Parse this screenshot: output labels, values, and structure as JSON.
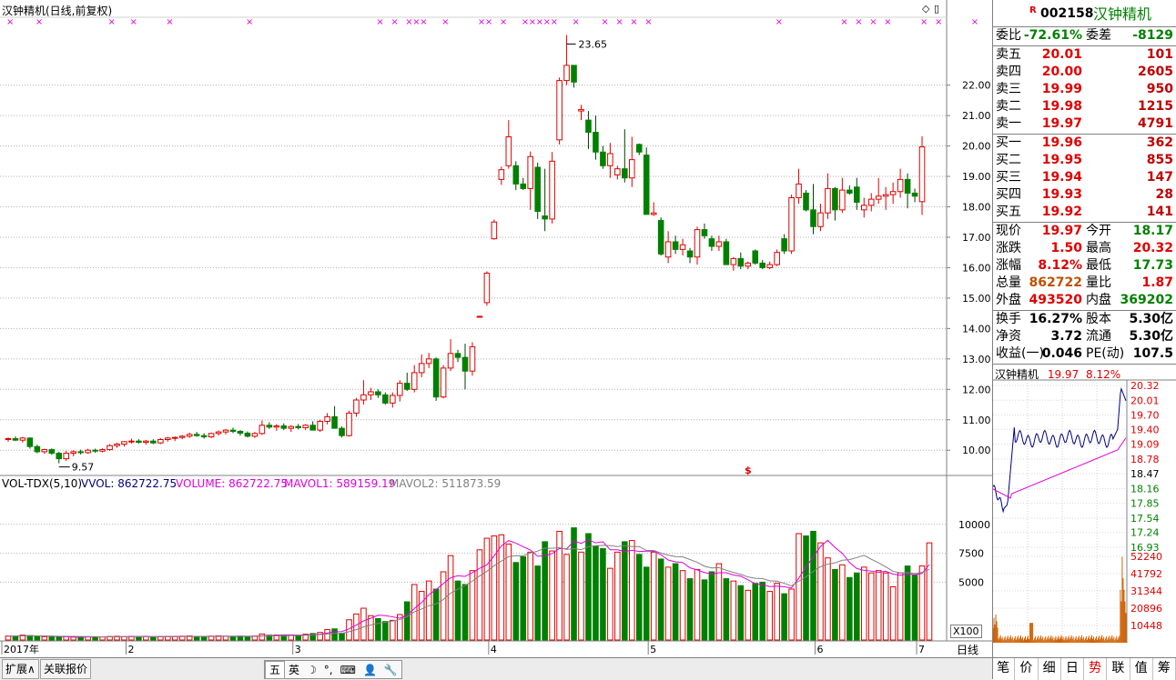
{
  "chart_header": {
    "title": "汉钟精机(日线,前复权)",
    "high_label": "23.65",
    "low_label": "9.57",
    "price_ticks": [
      "22.00",
      "21.00",
      "20.00",
      "19.00",
      "18.00",
      "17.00",
      "16.00",
      "15.00",
      "14.00",
      "13.00",
      "12.00",
      "11.00",
      "10.00"
    ],
    "marker": "$"
  },
  "volume_header": {
    "name": "VOL-TDX(5,10)",
    "vvol": "VVOL: 862722.75",
    "volume": "VOLUME: 862722.75",
    "mavol1": "MAVOL1: 589159.19",
    "mavol2": "MAVOL2: 511873.59",
    "ticks": [
      "10000",
      "7500",
      "5000"
    ],
    "scale": "X100"
  },
  "x_axis": {
    "labels": [
      "2017年",
      "2",
      "3",
      "4",
      "5",
      "6",
      "7"
    ],
    "period": "日线"
  },
  "bottom_bar": {
    "expand_btn": "扩展",
    "related_btn": "关联报价",
    "ime": [
      "五",
      "英",
      "☽",
      "°,",
      "⌨",
      "👤",
      "🔧"
    ]
  },
  "quote": {
    "flag": "R",
    "code": "002158",
    "name": "汉钟精机",
    "weibi_label": "委比",
    "weibi": "-72.61%",
    "weicha_label": "委差",
    "weicha": "-8129",
    "asks": [
      {
        "label": "卖五",
        "price": "20.01",
        "vol": "101"
      },
      {
        "label": "卖四",
        "price": "20.00",
        "vol": "2605"
      },
      {
        "label": "卖三",
        "price": "19.99",
        "vol": "950"
      },
      {
        "label": "卖二",
        "price": "19.98",
        "vol": "1215"
      },
      {
        "label": "卖一",
        "price": "19.97",
        "vol": "4791"
      }
    ],
    "bids": [
      {
        "label": "买一",
        "price": "19.96",
        "vol": "362"
      },
      {
        "label": "买二",
        "price": "19.95",
        "vol": "855"
      },
      {
        "label": "买三",
        "price": "19.94",
        "vol": "147"
      },
      {
        "label": "买四",
        "price": "19.93",
        "vol": "28"
      },
      {
        "label": "买五",
        "price": "19.92",
        "vol": "141"
      }
    ],
    "stats": [
      {
        "l1": "现价",
        "v1": "19.97",
        "l2": "今开",
        "v2": "18.17"
      },
      {
        "l1": "涨跌",
        "v1": "1.50",
        "l2": "最高",
        "v2": "20.32"
      },
      {
        "l1": "涨幅",
        "v1": "8.12%",
        "l2": "最低",
        "v2": "17.73"
      },
      {
        "l1": "总量",
        "v1": "862722",
        "l2": "量比",
        "v2": "1.87"
      },
      {
        "l1": "外盘",
        "v1": "493520",
        "l2": "内盘",
        "v2": "369202"
      }
    ],
    "fund": [
      {
        "l1": "换手",
        "v1": "16.27%",
        "l2": "股本",
        "v2": "5.30亿"
      },
      {
        "l1": "净资",
        "v1": "3.72",
        "l2": "流通",
        "v2": "5.30亿"
      },
      {
        "l1": "收益(一)",
        "v1": "0.046",
        "l2": "PE(动)",
        "v2": "107.5"
      }
    ]
  },
  "mini_chart": {
    "name": "汉钟精机",
    "price": "19.97",
    "pct": "8.12%",
    "price_ticks": [
      "20.32",
      "20.01",
      "19.70",
      "19.40",
      "19.09",
      "18.78",
      "18.47",
      "18.16",
      "17.85",
      "17.54",
      "17.24",
      "16.93"
    ],
    "vol_ticks": [
      "52240",
      "41792",
      "31344",
      "20896",
      "10448"
    ]
  },
  "tabs": [
    "笔",
    "价",
    "细",
    "日",
    "势",
    "联",
    "值",
    "筹"
  ],
  "active_tab": "势",
  "colors": {
    "up": "#e00000",
    "down": "#008000",
    "magenta": "#e000e0",
    "ma2": "#808080",
    "blue": "#000080"
  },
  "chart_data": {
    "type": "candlestick",
    "ohlc": [
      [
        10.35,
        10.42,
        10.28,
        10.38
      ],
      [
        10.38,
        10.45,
        10.3,
        10.33
      ],
      [
        10.33,
        10.44,
        10.25,
        10.4
      ],
      [
        10.4,
        10.42,
        10.05,
        10.12
      ],
      [
        10.12,
        10.18,
        9.9,
        9.95
      ],
      [
        9.95,
        10.05,
        9.88,
        10.02
      ],
      [
        10.02,
        10.06,
        9.85,
        9.9
      ],
      [
        9.9,
        9.95,
        9.57,
        9.72
      ],
      [
        9.72,
        9.98,
        9.65,
        9.9
      ],
      [
        9.9,
        10.0,
        9.8,
        9.95
      ],
      [
        9.95,
        10.02,
        9.86,
        9.92
      ],
      [
        9.92,
        10.05,
        9.88,
        10.0
      ],
      [
        10.0,
        10.05,
        9.92,
        9.97
      ],
      [
        9.97,
        10.06,
        9.93,
        10.02
      ],
      [
        10.02,
        10.2,
        9.98,
        10.15
      ],
      [
        10.15,
        10.25,
        10.08,
        10.2
      ],
      [
        10.2,
        10.3,
        10.12,
        10.28
      ],
      [
        10.28,
        10.38,
        10.22,
        10.3
      ],
      [
        10.3,
        10.36,
        10.22,
        10.26
      ],
      [
        10.26,
        10.34,
        10.18,
        10.3
      ],
      [
        10.3,
        10.36,
        10.2,
        10.24
      ],
      [
        10.24,
        10.4,
        10.2,
        10.35
      ],
      [
        10.35,
        10.44,
        10.28,
        10.4
      ],
      [
        10.4,
        10.45,
        10.3,
        10.42
      ],
      [
        10.42,
        10.5,
        10.36,
        10.46
      ],
      [
        10.46,
        10.58,
        10.4,
        10.52
      ],
      [
        10.52,
        10.6,
        10.44,
        10.48
      ],
      [
        10.48,
        10.56,
        10.38,
        10.44
      ],
      [
        10.44,
        10.58,
        10.4,
        10.55
      ],
      [
        10.55,
        10.65,
        10.48,
        10.6
      ],
      [
        10.6,
        10.7,
        10.52,
        10.66
      ],
      [
        10.66,
        10.74,
        10.56,
        10.62
      ],
      [
        10.62,
        10.66,
        10.48,
        10.56
      ],
      [
        10.56,
        10.62,
        10.42,
        10.46
      ],
      [
        10.46,
        10.6,
        10.4,
        10.55
      ],
      [
        10.55,
        10.98,
        10.5,
        10.82
      ],
      [
        10.82,
        10.92,
        10.7,
        10.76
      ],
      [
        10.76,
        10.86,
        10.64,
        10.8
      ],
      [
        10.8,
        10.88,
        10.66,
        10.72
      ],
      [
        10.72,
        10.82,
        10.6,
        10.78
      ],
      [
        10.78,
        10.86,
        10.68,
        10.74
      ],
      [
        10.74,
        10.86,
        10.66,
        10.82
      ],
      [
        10.82,
        10.95,
        10.7,
        10.66
      ],
      [
        10.66,
        11.0,
        10.6,
        10.95
      ],
      [
        10.95,
        11.22,
        10.85,
        11.1
      ],
      [
        11.1,
        11.45,
        10.95,
        10.72
      ],
      [
        10.72,
        10.78,
        10.42,
        10.48
      ],
      [
        10.48,
        11.3,
        10.45,
        11.22
      ],
      [
        11.22,
        11.72,
        11.1,
        11.65
      ],
      [
        11.65,
        12.3,
        11.5,
        11.82
      ],
      [
        11.82,
        12.05,
        11.65,
        11.92
      ],
      [
        11.92,
        12.0,
        11.72,
        11.82
      ],
      [
        11.82,
        11.9,
        11.5,
        11.55
      ],
      [
        11.55,
        11.9,
        11.4,
        11.8
      ],
      [
        11.8,
        12.3,
        11.6,
        12.2
      ],
      [
        12.2,
        12.55,
        11.95,
        12.0
      ],
      [
        12.0,
        12.8,
        11.9,
        12.55
      ],
      [
        12.55,
        13.15,
        12.4,
        12.85
      ],
      [
        12.85,
        13.2,
        12.7,
        13.0
      ],
      [
        13.0,
        13.05,
        11.62,
        11.75
      ],
      [
        11.75,
        12.8,
        11.7,
        12.7
      ],
      [
        12.7,
        13.65,
        12.6,
        13.18
      ],
      [
        13.18,
        13.3,
        12.9,
        13.05
      ],
      [
        13.05,
        13.5,
        12.0,
        12.6
      ],
      [
        12.6,
        13.55,
        12.45,
        13.4
      ],
      [
        14.38,
        14.42,
        14.38,
        14.4
      ],
      [
        14.85,
        15.88,
        14.75,
        15.82
      ],
      [
        16.95,
        17.58,
        16.92,
        17.5
      ],
      [
        18.9,
        19.32,
        18.72,
        19.22
      ],
      [
        19.35,
        20.85,
        19.25,
        20.3
      ],
      [
        19.35,
        19.5,
        18.55,
        18.75
      ],
      [
        18.75,
        18.95,
        18.55,
        18.6
      ],
      [
        18.6,
        19.82,
        17.9,
        19.65
      ],
      [
        19.3,
        19.45,
        17.6,
        17.85
      ],
      [
        17.7,
        19.25,
        17.2,
        17.6
      ],
      [
        17.6,
        19.8,
        17.45,
        19.5
      ],
      [
        20.2,
        22.25,
        20.05,
        22.15
      ],
      [
        22.15,
        23.65,
        22.0,
        22.65
      ],
      [
        22.65,
        22.65,
        21.92,
        22.1
      ],
      [
        21.15,
        21.35,
        20.85,
        21.2
      ],
      [
        20.85,
        21.15,
        19.9,
        20.45
      ],
      [
        20.45,
        21.0,
        19.55,
        19.8
      ],
      [
        19.8,
        20.0,
        19.25,
        19.35
      ],
      [
        19.35,
        20.1,
        18.95,
        19.75
      ],
      [
        19.05,
        19.35,
        18.9,
        19.25
      ],
      [
        19.25,
        20.55,
        18.8,
        18.95
      ],
      [
        18.95,
        20.3,
        18.65,
        19.55
      ],
      [
        20.05,
        20.08,
        19.7,
        19.8
      ],
      [
        19.7,
        19.95,
        17.75,
        17.75
      ],
      [
        17.75,
        18.15,
        17.7,
        17.8
      ],
      [
        17.55,
        17.65,
        16.4,
        16.45
      ],
      [
        16.35,
        17.2,
        16.15,
        16.85
      ],
      [
        16.85,
        17.05,
        16.45,
        16.6
      ],
      [
        16.6,
        16.95,
        16.4,
        16.75
      ],
      [
        16.55,
        16.65,
        16.15,
        16.35
      ],
      [
        16.35,
        17.35,
        16.1,
        17.25
      ],
      [
        17.25,
        17.45,
        16.95,
        17.05
      ],
      [
        16.95,
        17.05,
        16.55,
        16.7
      ],
      [
        16.7,
        17.05,
        16.55,
        16.85
      ],
      [
        16.85,
        16.95,
        16.1,
        16.1
      ],
      [
        16.1,
        16.35,
        15.9,
        16.3
      ],
      [
        16.3,
        16.5,
        15.95,
        16.05
      ],
      [
        16.05,
        16.2,
        15.95,
        16.15
      ],
      [
        16.55,
        16.6,
        16.1,
        16.15
      ],
      [
        16.15,
        16.25,
        15.95,
        16.0
      ],
      [
        16.0,
        16.2,
        15.95,
        16.1
      ],
      [
        16.1,
        16.6,
        16.05,
        16.5
      ],
      [
        16.95,
        17.1,
        16.45,
        16.55
      ],
      [
        16.55,
        18.4,
        16.45,
        18.3
      ],
      [
        18.3,
        19.25,
        18.1,
        18.75
      ],
      [
        18.45,
        18.55,
        17.85,
        17.9
      ],
      [
        17.9,
        18.75,
        17.1,
        17.35
      ],
      [
        17.35,
        18.1,
        17.2,
        17.8
      ],
      [
        17.8,
        19.1,
        17.6,
        18.6
      ],
      [
        18.6,
        18.65,
        17.55,
        17.9
      ],
      [
        17.9,
        18.95,
        17.8,
        18.55
      ],
      [
        18.55,
        18.7,
        18.4,
        18.45
      ],
      [
        18.65,
        18.95,
        17.9,
        18.15
      ],
      [
        17.9,
        18.3,
        17.65,
        18.05
      ],
      [
        18.05,
        18.45,
        17.85,
        18.25
      ],
      [
        18.25,
        18.95,
        18.1,
        18.35
      ],
      [
        18.35,
        18.65,
        17.9,
        18.4
      ],
      [
        18.4,
        18.8,
        18.1,
        18.5
      ],
      [
        18.5,
        19.25,
        18.3,
        18.9
      ],
      [
        18.9,
        19.1,
        17.95,
        18.45
      ],
      [
        18.45,
        18.6,
        18.15,
        18.35
      ],
      [
        18.17,
        20.32,
        17.73,
        19.97
      ]
    ],
    "volume": [
      340,
      330,
      420,
      380,
      300,
      290,
      260,
      250,
      280,
      250,
      260,
      270,
      280,
      270,
      300,
      320,
      280,
      310,
      290,
      300,
      270,
      290,
      310,
      300,
      330,
      350,
      300,
      290,
      330,
      360,
      330,
      310,
      330,
      300,
      340,
      520,
      420,
      430,
      440,
      410,
      400,
      500,
      560,
      650,
      900,
      960,
      580,
      1750,
      2250,
      2750,
      2100,
      1850,
      1600,
      1700,
      2200,
      3300,
      4800,
      4200,
      5100,
      4400,
      5900,
      7300,
      5100,
      4800,
      6000,
      7800,
      8800,
      9000,
      9100,
      8300,
      6700,
      7200,
      7600,
      6400,
      8500,
      7700,
      9400,
      7400,
      9700,
      7600,
      9200,
      8100,
      7900,
      6200,
      7600,
      8500,
      8600,
      7400,
      6300,
      7600,
      7000,
      6300,
      6600,
      6000,
      5300,
      6100,
      5200,
      5900,
      6600,
      5300,
      5100,
      4700,
      4300,
      4900,
      5000,
      4200,
      4900,
      4000,
      4400,
      9200,
      9000,
      9400,
      8400,
      7100,
      6100,
      6500,
      5400,
      5800,
      6300,
      5800,
      6000,
      5800,
      4600,
      5800,
      6400,
      5600,
      6400,
      8400
    ],
    "ylim": [
      9.2,
      24.2
    ]
  }
}
